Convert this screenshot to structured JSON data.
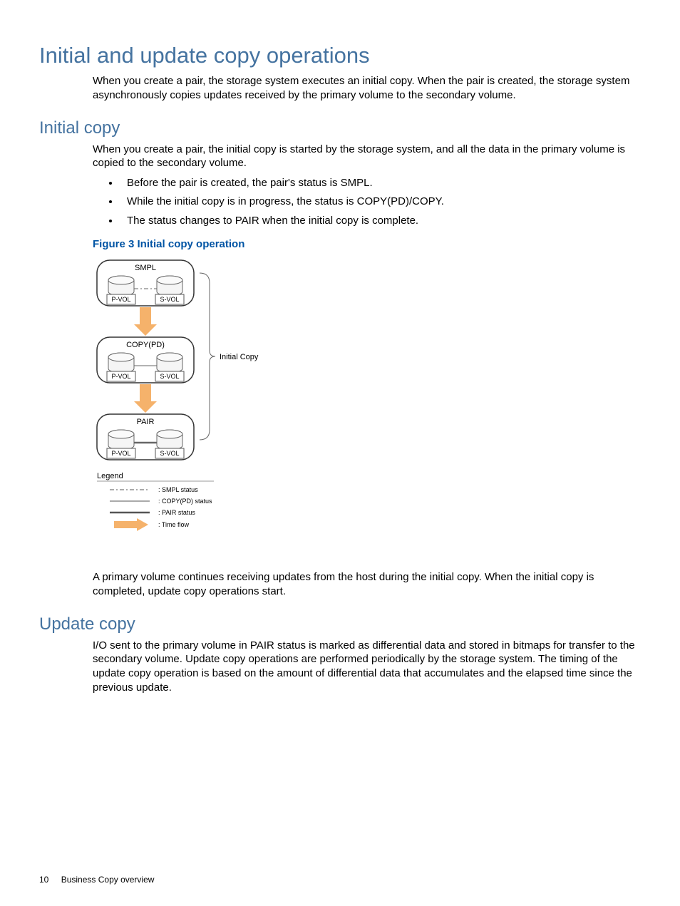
{
  "h1": "Initial and update copy operations",
  "intro": "When you create a pair, the storage system executes an initial copy. When the pair is created, the storage system asynchronously copies updates received by the primary volume to the secondary volume.",
  "section_initial": {
    "heading": "Initial copy",
    "para1": "When you create a pair, the initial copy is started by the storage system, and all the data in the primary volume is copied to the secondary volume.",
    "bullets": [
      "Before the pair is created, the pair's status is SMPL.",
      "While the initial copy is in progress, the status is COPY(PD)/COPY.",
      "The status changes to PAIR when the initial copy is complete."
    ],
    "figure_caption": "Figure 3 Initial copy operation",
    "para2": "A primary volume continues receiving updates from the host during the initial copy. When the initial copy is completed, update copy operations start."
  },
  "section_update": {
    "heading": "Update copy",
    "para1": "I/O sent to the primary volume in PAIR status is marked as differential data and stored in bitmaps for transfer to the secondary volume. Update copy operations are performed periodically by the storage system. The timing of the update copy operation is based on the amount of differential data that accumulates and the elapsed time since the previous update."
  },
  "diagram": {
    "stage1": {
      "title": "SMPL",
      "left": "P-VOL",
      "right": "S-VOL"
    },
    "stage2": {
      "title": "COPY(PD)",
      "left": "P-VOL",
      "right": "S-VOL"
    },
    "stage3": {
      "title": "PAIR",
      "left": "P-VOL",
      "right": "S-VOL"
    },
    "side_label": "Initial Copy",
    "legend_title": "Legend",
    "legend": {
      "l1": ": SMPL status",
      "l2": ": COPY(PD) status",
      "l3": ": PAIR status",
      "l4": ": Time flow"
    }
  },
  "footer": {
    "page": "10",
    "title": "Business Copy overview"
  }
}
